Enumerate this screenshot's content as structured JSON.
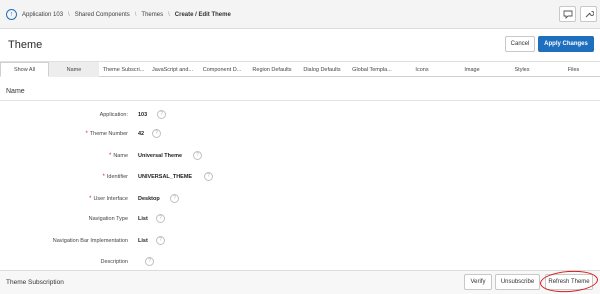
{
  "breadcrumb": {
    "items": [
      "Application 103",
      "Shared Components",
      "Themes"
    ],
    "current": "Create / Edit Theme",
    "separator": "\\"
  },
  "toolbar": {
    "icons": [
      "up-arrow-icon",
      "comment-icon",
      "wrench-icon"
    ]
  },
  "page": {
    "title": "Theme",
    "cancel_label": "Cancel",
    "apply_label": "Apply Changes"
  },
  "tabs": [
    {
      "label": "Show All",
      "state": "active"
    },
    {
      "label": "Name",
      "state": "selected"
    },
    {
      "label": "Theme Subscri..."
    },
    {
      "label": "JavaScript and..."
    },
    {
      "label": "Component D..."
    },
    {
      "label": "Region Defaults"
    },
    {
      "label": "Dialog Defaults"
    },
    {
      "label": "Global Templa..."
    },
    {
      "label": "Icons"
    },
    {
      "label": "Image"
    },
    {
      "label": "Styles"
    },
    {
      "label": "Files"
    }
  ],
  "region": {
    "title": "Name"
  },
  "fields": [
    {
      "label": "Application:",
      "required": false,
      "value": "103"
    },
    {
      "label": "Theme Number",
      "required": true,
      "value": "42"
    },
    {
      "label": "Name",
      "required": true,
      "value": "Universal Theme"
    },
    {
      "label": "Identifier",
      "required": true,
      "value": "UNIVERSAL_THEME"
    },
    {
      "label": "User Interface",
      "required": true,
      "value": "Desktop"
    },
    {
      "label": "Navigation Type",
      "required": false,
      "value": "List"
    },
    {
      "label": "Navigation Bar Implementation",
      "required": false,
      "value": "List"
    },
    {
      "label": "Description",
      "required": false,
      "value": ""
    }
  ],
  "help_glyph": "?",
  "required_glyph": "*",
  "subscription": {
    "title": "Theme Subscription",
    "verify_label": "Verify",
    "unsubscribe_label": "Unsubscribe",
    "refresh_label": "Refresh Theme"
  },
  "colors": {
    "accent": "#1f6fbf",
    "required": "#e02020",
    "annotation": "#d91c1c"
  }
}
